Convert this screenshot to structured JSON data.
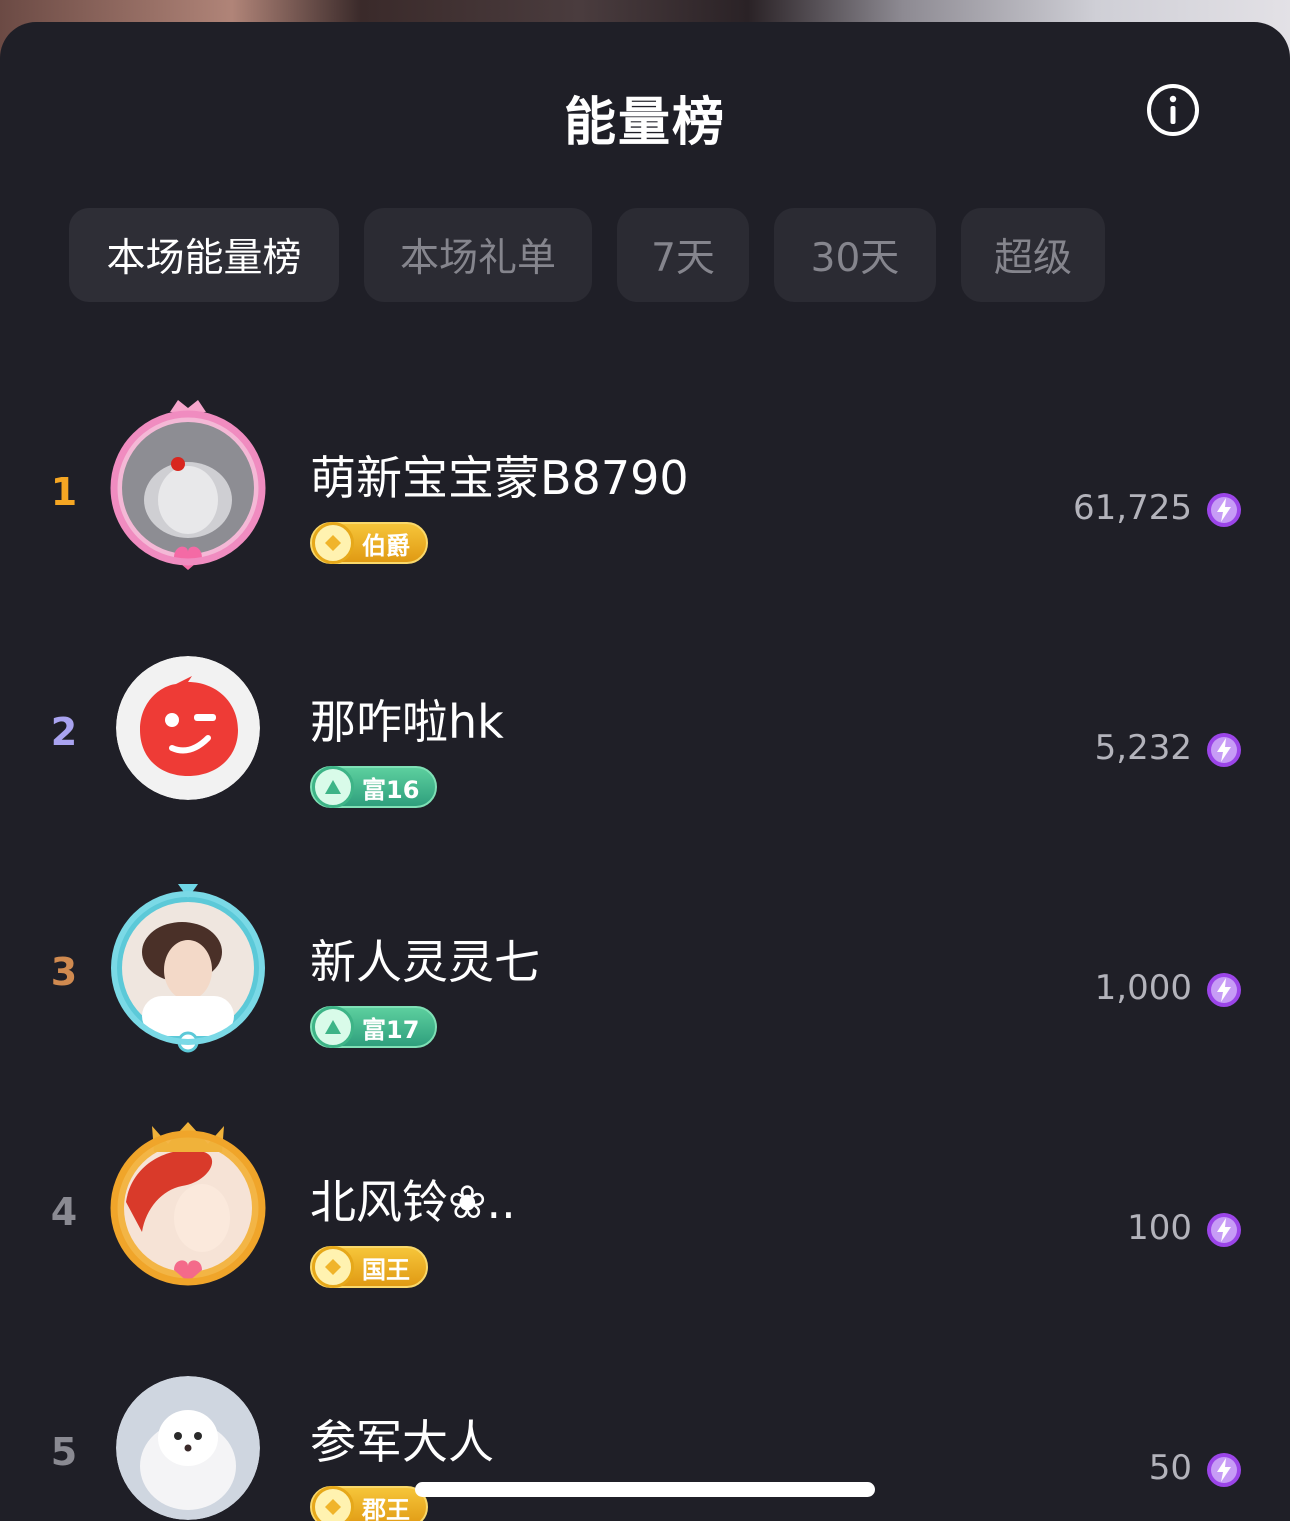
{
  "header": {
    "title": "能量榜",
    "info_icon": "info-circle-icon"
  },
  "tabs": [
    {
      "label": "本场能量榜",
      "active": true
    },
    {
      "label": "本场礼单",
      "active": false
    },
    {
      "label": "7天",
      "active": false
    },
    {
      "label": "30天",
      "active": false
    },
    {
      "label": "超级",
      "active": false
    }
  ],
  "colors": {
    "rank_1": "#f5a623",
    "rank_2": "#a9a3f0",
    "rank_3": "#d08a50",
    "rank_other": "#8a8a92",
    "energy": "#9b45e8"
  },
  "leaderboard": [
    {
      "rank": "1",
      "name": "萌新宝宝蒙B8790",
      "badge": "伯爵",
      "badge_style": "gold",
      "score": "61,725",
      "energy_icon": "energy-bolt-icon"
    },
    {
      "rank": "2",
      "name": "那咋啦hk",
      "badge": "富16",
      "badge_style": "green",
      "score": "5,232",
      "energy_icon": "energy-bolt-icon"
    },
    {
      "rank": "3",
      "name": "新人灵灵七",
      "badge": "富17",
      "badge_style": "green",
      "score": "1,000",
      "energy_icon": "energy-bolt-icon"
    },
    {
      "rank": "4",
      "name": "北风铃❀..",
      "badge": "国王",
      "badge_style": "gold",
      "score": "100",
      "energy_icon": "energy-bolt-icon"
    },
    {
      "rank": "5",
      "name": "参军大人",
      "badge": "郡王",
      "badge_style": "gold",
      "score": "50",
      "energy_icon": "energy-bolt-icon"
    }
  ]
}
